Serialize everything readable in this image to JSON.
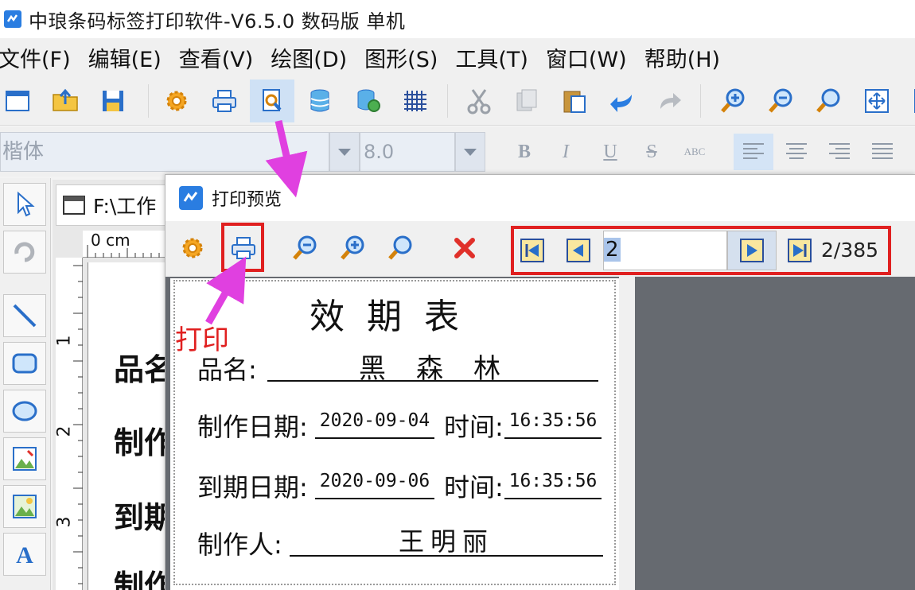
{
  "app": {
    "title": "中琅条码标签打印软件-V6.5.0 数码版 单机"
  },
  "menu": [
    {
      "label": "文件(F)"
    },
    {
      "label": "编辑(E)"
    },
    {
      "label": "查看(V)"
    },
    {
      "label": "绘图(D)"
    },
    {
      "label": "图形(S)"
    },
    {
      "label": "工具(T)"
    },
    {
      "label": "窗口(W)"
    },
    {
      "label": "帮助(H)"
    }
  ],
  "toolbar": {
    "icons": [
      "new-window-icon",
      "open-folder-icon",
      "save-icon",
      "settings-gear-icon",
      "printer-icon",
      "print-preview-icon",
      "database-icon",
      "database-settings-icon",
      "grid-icon",
      "cut-icon",
      "copy-icon",
      "paste-icon",
      "undo-icon",
      "redo-icon",
      "zoom-in-icon",
      "zoom-out-icon",
      "zoom-icon",
      "fit-page-icon"
    ],
    "active": "print-preview-icon"
  },
  "fontbar": {
    "font_name": "楷体",
    "font_size": "8.0",
    "bold": "B",
    "italic": "I",
    "underline": "U",
    "strike": "S",
    "abc": "ABC"
  },
  "document": {
    "tab_title": "F:\\工作",
    "ruler_unit": "0 cm",
    "ruler_marks": [
      "1",
      "2",
      "3"
    ],
    "canvas_labels": [
      "品名",
      "制作",
      "到期",
      "制作"
    ]
  },
  "preview": {
    "title": "打印预览",
    "page_input": "2",
    "page_count": "2/385",
    "label": {
      "title": "效期表",
      "name_label": "品名:",
      "name_value": "黑森林",
      "made_date_label": "制作日期:",
      "made_date_value": "2020-09-04",
      "made_time_label": "时间:",
      "made_time_value": "16:35:56",
      "expire_date_label": "到期日期:",
      "expire_date_value": "2020-09-06",
      "expire_time_label": "时间:",
      "expire_time_value": "16:35:56",
      "maker_label": "制作人:",
      "maker_value": "王明丽"
    }
  },
  "annotation": {
    "print_text": "打印",
    "color": "#e02020",
    "arrow_color": "#e040e0"
  }
}
